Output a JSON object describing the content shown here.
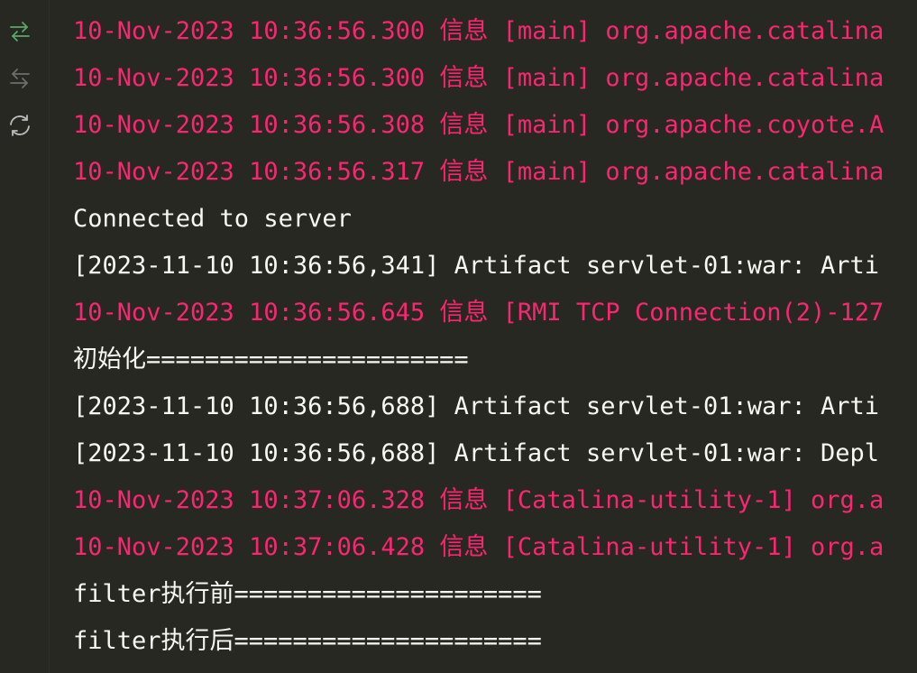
{
  "toolbar": {
    "buttons": [
      {
        "name": "rerun-icon",
        "color": "#59a869"
      },
      {
        "name": "stop-icon",
        "color": "#6e6e6a"
      },
      {
        "name": "restart-icon",
        "color": "#bbbbbb"
      }
    ]
  },
  "colors": {
    "background": "#272822",
    "error_text": "#f92672",
    "normal_text": "#f8f8f2"
  },
  "console": {
    "lines": [
      {
        "text": "10-Nov-2023 10:36:56.300 信息 [main] org.apache.catalina",
        "kind": "err"
      },
      {
        "text": "10-Nov-2023 10:36:56.300 信息 [main] org.apache.catalina",
        "kind": "err"
      },
      {
        "text": "10-Nov-2023 10:36:56.308 信息 [main] org.apache.coyote.A",
        "kind": "err"
      },
      {
        "text": "10-Nov-2023 10:36:56.317 信息 [main] org.apache.catalina",
        "kind": "err"
      },
      {
        "text": "Connected to server",
        "kind": "out"
      },
      {
        "text": "[2023-11-10 10:36:56,341] Artifact servlet-01:war: Arti",
        "kind": "out"
      },
      {
        "text": "10-Nov-2023 10:36:56.645 信息 [RMI TCP Connection(2)-127",
        "kind": "err"
      },
      {
        "text": "初始化======================",
        "kind": "out"
      },
      {
        "text": "[2023-11-10 10:36:56,688] Artifact servlet-01:war: Arti",
        "kind": "out"
      },
      {
        "text": "[2023-11-10 10:36:56,688] Artifact servlet-01:war: Depl",
        "kind": "out"
      },
      {
        "text": "10-Nov-2023 10:37:06.328 信息 [Catalina-utility-1] org.a",
        "kind": "err"
      },
      {
        "text": "10-Nov-2023 10:37:06.428 信息 [Catalina-utility-1] org.a",
        "kind": "err"
      },
      {
        "text": "filter执行前=====================",
        "kind": "out"
      },
      {
        "text": "filter执行后=====================",
        "kind": "out"
      }
    ]
  }
}
